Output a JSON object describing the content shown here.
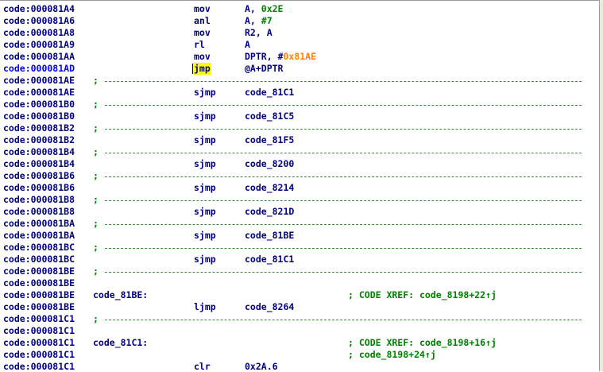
{
  "colors": {
    "address": "#000080",
    "address_current": "#0000ff",
    "instruction": "#000080",
    "number": "#008000",
    "hex_address": "#ff8000",
    "comment": "#008000",
    "highlight": "#ffff00"
  },
  "listing": [
    {
      "kind": "instr",
      "addr": "code:000081A4",
      "mnem": "mov",
      "ops": [
        {
          "t": "A, "
        },
        {
          "t": "0x2E",
          "c": "num"
        }
      ]
    },
    {
      "kind": "instr",
      "addr": "code:000081A6",
      "mnem": "anl",
      "ops": [
        {
          "t": "A, "
        },
        {
          "t": "#7",
          "c": "num"
        }
      ]
    },
    {
      "kind": "instr",
      "addr": "code:000081A8",
      "mnem": "mov",
      "ops": [
        {
          "t": "R2, A"
        }
      ]
    },
    {
      "kind": "instr",
      "addr": "code:000081A9",
      "mnem": "rl",
      "ops": [
        {
          "t": "A"
        }
      ]
    },
    {
      "kind": "instr",
      "addr": "code:000081AA",
      "mnem": "mov",
      "ops": [
        {
          "t": "DPTR, #"
        },
        {
          "t": "0x81AE",
          "c": "hex"
        }
      ]
    },
    {
      "kind": "instr",
      "addr": "code:000081AD",
      "mnem": "jmp",
      "current": true,
      "ops": [
        {
          "t": "@A+DPTR"
        }
      ]
    },
    {
      "kind": "sep",
      "addr": "code:000081AE",
      "semi": ";"
    },
    {
      "kind": "instr",
      "addr": "code:000081AE",
      "mnem": "sjmp",
      "ops": [
        {
          "t": "code_81C1",
          "c": "name"
        }
      ]
    },
    {
      "kind": "sep",
      "addr": "code:000081B0",
      "semi": ";"
    },
    {
      "kind": "instr",
      "addr": "code:000081B0",
      "mnem": "sjmp",
      "ops": [
        {
          "t": "code_81C5",
          "c": "name"
        }
      ]
    },
    {
      "kind": "sep",
      "addr": "code:000081B2",
      "semi": ";"
    },
    {
      "kind": "instr",
      "addr": "code:000081B2",
      "mnem": "sjmp",
      "ops": [
        {
          "t": "code_81F5",
          "c": "name"
        }
      ]
    },
    {
      "kind": "sep",
      "addr": "code:000081B4",
      "semi": ";"
    },
    {
      "kind": "instr",
      "addr": "code:000081B4",
      "mnem": "sjmp",
      "ops": [
        {
          "t": "code_8200",
          "c": "name"
        }
      ]
    },
    {
      "kind": "sep",
      "addr": "code:000081B6",
      "semi": ";"
    },
    {
      "kind": "instr",
      "addr": "code:000081B6",
      "mnem": "sjmp",
      "ops": [
        {
          "t": "code_8214",
          "c": "name"
        }
      ]
    },
    {
      "kind": "sep",
      "addr": "code:000081B8",
      "semi": ";"
    },
    {
      "kind": "instr",
      "addr": "code:000081B8",
      "mnem": "sjmp",
      "ops": [
        {
          "t": "code_821D",
          "c": "name"
        }
      ]
    },
    {
      "kind": "sep",
      "addr": "code:000081BA",
      "semi": ";"
    },
    {
      "kind": "instr",
      "addr": "code:000081BA",
      "mnem": "sjmp",
      "ops": [
        {
          "t": "code_81BE",
          "c": "name"
        }
      ]
    },
    {
      "kind": "sep",
      "addr": "code:000081BC",
      "semi": ";"
    },
    {
      "kind": "instr",
      "addr": "code:000081BC",
      "mnem": "sjmp",
      "ops": [
        {
          "t": "code_81C1",
          "c": "name"
        }
      ]
    },
    {
      "kind": "sep",
      "addr": "code:000081BE",
      "semi": ";"
    },
    {
      "kind": "blank",
      "addr": "code:000081BE"
    },
    {
      "kind": "label",
      "addr": "code:000081BE",
      "label": "code_81BE:",
      "comment": "; CODE XREF: code_8198+22↑j"
    },
    {
      "kind": "instr",
      "addr": "code:000081BE",
      "mnem": "ljmp",
      "ops": [
        {
          "t": "code_8264",
          "c": "name"
        }
      ]
    },
    {
      "kind": "sep",
      "addr": "code:000081C1",
      "semi": ";"
    },
    {
      "kind": "blank",
      "addr": "code:000081C1"
    },
    {
      "kind": "label",
      "addr": "code:000081C1",
      "label": "code_81C1:",
      "comment": "; CODE XREF: code_8198+16↑j"
    },
    {
      "kind": "comment",
      "addr": "code:000081C1",
      "comment": "; code_8198+24↑j"
    },
    {
      "kind": "instr",
      "addr": "code:000081C1",
      "mnem": "clr",
      "ops": [
        {
          "t": "0x2A.6"
        }
      ]
    }
  ]
}
